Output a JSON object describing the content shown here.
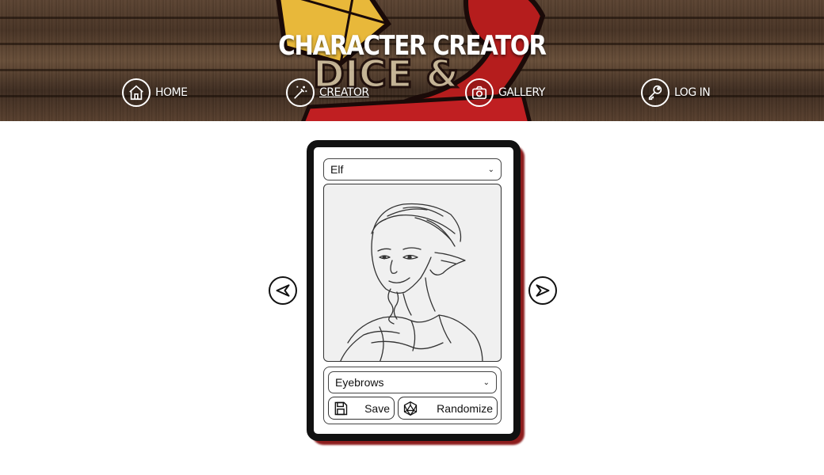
{
  "header": {
    "title": "CHARACTER CREATOR",
    "logo_text": "DICE &"
  },
  "nav": [
    {
      "label": "HOME",
      "icon": "home-icon",
      "active": false
    },
    {
      "label": "CREATOR",
      "icon": "magic-wand-icon",
      "active": true
    },
    {
      "label": "GALLERY",
      "icon": "camera-icon",
      "active": false
    },
    {
      "label": "LOG IN",
      "icon": "key-icon",
      "active": false
    }
  ],
  "creator": {
    "race_select": {
      "value": "Elf"
    },
    "feature_select": {
      "value": "Eyebrows"
    },
    "save_button": {
      "label": "Save",
      "icon": "floppy-disk-icon"
    },
    "randomize_button": {
      "label": "Randomize",
      "icon": "d20-dice-icon"
    },
    "prev_arrow": {
      "icon": "arrow-left-icon"
    },
    "next_arrow": {
      "icon": "arrow-right-icon"
    }
  },
  "colors": {
    "card_border": "#111111",
    "card_shadow": "#8c1c1c",
    "nav_text": "#ffffff",
    "portrait_bg": "#f0f0f0"
  }
}
